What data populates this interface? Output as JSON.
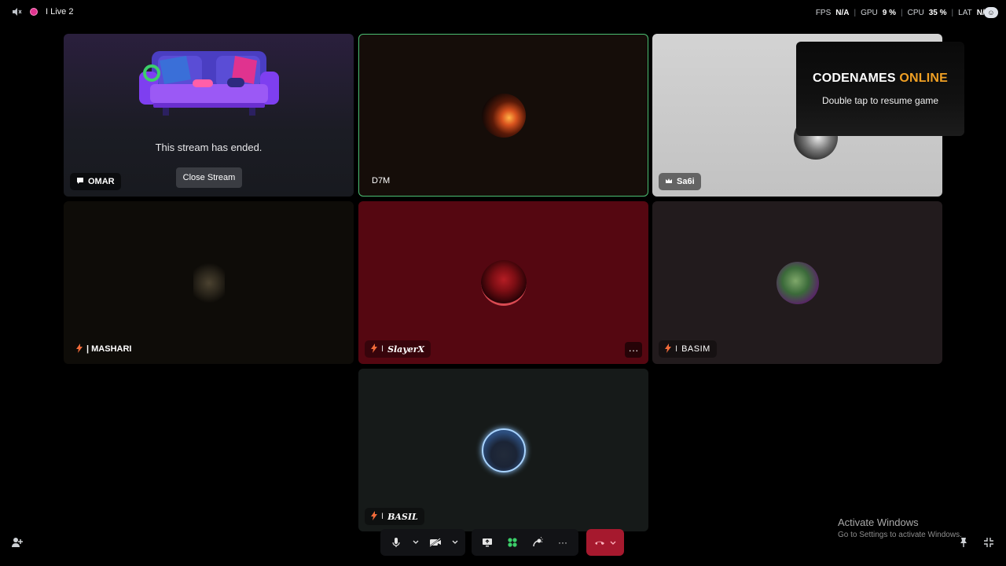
{
  "topbar": {
    "live_label": "I Live 2",
    "stats": {
      "fps_label": "FPS",
      "fps_value": "N/A",
      "gpu_label": "GPU",
      "gpu_value": "9 %",
      "cpu_label": "CPU",
      "cpu_value": "35 %",
      "lat_label": "LAT",
      "lat_value": "N/A"
    },
    "separator": "|"
  },
  "tiles": {
    "omar": {
      "name": "OMAR",
      "ended_text": "This stream has ended.",
      "close_label": "Close Stream"
    },
    "d7m": {
      "name": "D7M"
    },
    "sa6i": {
      "name": "Sa6i"
    },
    "mashari": {
      "name": "| MASHARI"
    },
    "slayerx": {
      "name": "SlayerX",
      "more": "···"
    },
    "basim": {
      "name": "BASIM"
    },
    "basil": {
      "name": "BASIL"
    },
    "name_prefix": "I"
  },
  "game_overlay": {
    "title_main": "CODENAMES",
    "title_accent": "ONLINE",
    "subtitle": "Double tap to resume game",
    "accent_color": "#f0a024"
  },
  "controls": {
    "more": "···"
  },
  "watermark": {
    "line1": "Activate Windows",
    "line2": "Go to Settings to activate Windows."
  },
  "colors": {
    "speaking_border": "#4bbf73",
    "hangup": "#a6192e",
    "live_dot": "#e0338f"
  }
}
